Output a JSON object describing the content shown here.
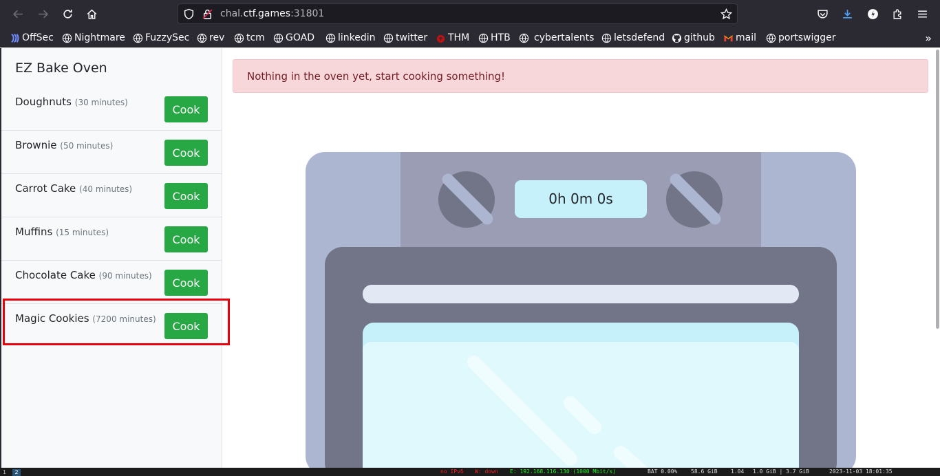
{
  "browser": {
    "url_prefix": "chal.",
    "url_domain": "ctf.games",
    "url_port": ":31801",
    "bookmarks": [
      "OffSec",
      "Nightmare",
      "FuzzySec",
      "rev",
      "tcm",
      "GOAD",
      "linkedin",
      "twitter",
      "THM",
      "HTB",
      "cybertalents",
      "letsdefend",
      "github",
      "mail",
      "portswigger"
    ]
  },
  "sidebar": {
    "title": "EZ Bake Oven",
    "cook_label": "Cook",
    "recipes": [
      {
        "name": "Doughnuts",
        "duration": "(30 minutes)"
      },
      {
        "name": "Brownie",
        "duration": "(50 minutes)"
      },
      {
        "name": "Carrot Cake",
        "duration": "(40 minutes)"
      },
      {
        "name": "Muffins",
        "duration": "(15 minutes)"
      },
      {
        "name": "Chocolate Cake",
        "duration": "(90 minutes)"
      },
      {
        "name": "Magic Cookies",
        "duration": "(7200 minutes)"
      }
    ]
  },
  "alert": {
    "text": "Nothing in the oven yet, start cooking something!"
  },
  "oven": {
    "timer": "0h 0m 0s"
  },
  "colors": {
    "cook_button": "#28a745",
    "alert_bg": "#f8d7da",
    "alert_text": "#721c24",
    "highlight": "#e8000b",
    "oven_body": "#adb6d1",
    "oven_panel": "#9a9db3",
    "oven_door": "#717587",
    "oven_window": "#c6f1fb"
  },
  "statusbar": {
    "workspaces": [
      "1",
      "2"
    ],
    "items": [
      "no IPv6",
      "W: down",
      "E: 192.168.116.130 (1000 Mbit/s)",
      "BAT 0.00%",
      "58.6 GiB",
      "1.04",
      "1.0 GiB | 3.7 GiB",
      "2023-11-03 18:01:35"
    ]
  }
}
